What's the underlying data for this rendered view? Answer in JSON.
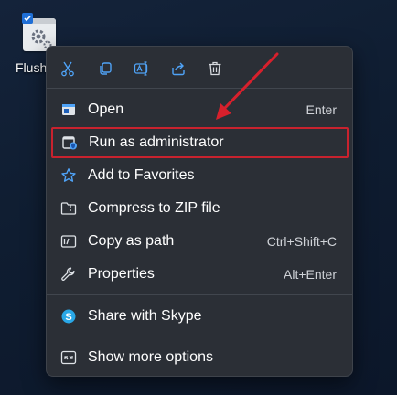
{
  "desktop": {
    "file_label": "Flush"
  },
  "quick_actions": [
    {
      "name": "cut",
      "icon": "scissors-icon"
    },
    {
      "name": "copy",
      "icon": "copy-icon"
    },
    {
      "name": "rename",
      "icon": "rename-icon"
    },
    {
      "name": "share",
      "icon": "share-icon"
    },
    {
      "name": "delete",
      "icon": "trash-icon"
    }
  ],
  "menu": {
    "items": [
      {
        "label": "Open",
        "shortcut": "Enter",
        "icon": "open-icon"
      },
      {
        "label": "Run as administrator",
        "shortcut": "",
        "icon": "shield-icon",
        "highlighted": true
      },
      {
        "label": "Add to Favorites",
        "shortcut": "",
        "icon": "star-icon"
      },
      {
        "label": "Compress to ZIP file",
        "shortcut": "",
        "icon": "zip-folder-icon"
      },
      {
        "label": "Copy as path",
        "shortcut": "Ctrl+Shift+C",
        "icon": "path-icon"
      },
      {
        "label": "Properties",
        "shortcut": "Alt+Enter",
        "icon": "wrench-icon"
      },
      {
        "label": "Share with Skype",
        "shortcut": "",
        "icon": "skype-icon"
      },
      {
        "label": "Show more options",
        "shortcut": "",
        "icon": "more-options-icon"
      }
    ]
  },
  "colors": {
    "accent": "#4fa3f7",
    "highlight_border": "#c8222e",
    "menu_bg": "#2b2f36",
    "arrow": "#d7202c"
  }
}
